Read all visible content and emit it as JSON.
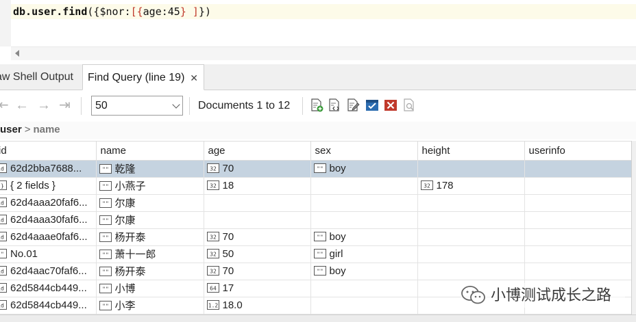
{
  "editor": {
    "code": {
      "t1": "db.user.find",
      "t2": "({",
      "t3": "$nor",
      "t4": ":",
      "t5": "[{",
      "t6": "age",
      "t7": ":",
      "t8": "45",
      "t9": "} ]",
      "t10": "})"
    }
  },
  "tabs": {
    "inactive_label": "aw Shell Output",
    "active_label": "Find Query (line 19)",
    "close_glyph": "✕"
  },
  "toolbar": {
    "nav": [
      "⇤",
      "←",
      "→",
      "⇥"
    ],
    "page_size": "50",
    "doc_count": "Documents 1 to 12",
    "icons": [
      "add-document-icon",
      "view-json-icon",
      "edit-document-icon",
      "save-icon",
      "delete-icon",
      "query-icon"
    ]
  },
  "breadcrumb": {
    "root": "user",
    "separator": ">",
    "current": "name"
  },
  "grid": {
    "columns": [
      "id",
      "name",
      "age",
      "sex",
      "height",
      "userinfo"
    ],
    "rows": [
      {
        "id": "62d2bba7688...",
        "id_type": "objectid",
        "name": "乾隆",
        "age": "70",
        "age_type": "int32",
        "sex": "boy",
        "height": "",
        "height_type": "",
        "selected": true
      },
      {
        "id": "{ 2 fields }",
        "id_type": "object",
        "name": "小燕子",
        "age": "18",
        "age_type": "int32",
        "sex": "",
        "height": "178",
        "height_type": "int32",
        "selected": false
      },
      {
        "id": "62d4aaa20faf6...",
        "id_type": "objectid",
        "name": "尔康",
        "age": "",
        "age_type": "",
        "sex": "",
        "height": "",
        "height_type": "",
        "selected": false
      },
      {
        "id": "62d4aaa30faf6...",
        "id_type": "objectid",
        "name": "尔康",
        "age": "",
        "age_type": "",
        "sex": "",
        "height": "",
        "height_type": "",
        "selected": false
      },
      {
        "id": "62d4aaae0faf6...",
        "id_type": "objectid",
        "name": "杨开泰",
        "age": "70",
        "age_type": "int32",
        "sex": "boy",
        "height": "",
        "height_type": "",
        "selected": false
      },
      {
        "id": "No.01",
        "id_type": "string",
        "name": "萧十一郎",
        "age": "50",
        "age_type": "int32",
        "sex": "girl",
        "height": "",
        "height_type": "",
        "selected": false
      },
      {
        "id": "62d4aac70faf6...",
        "id_type": "objectid",
        "name": "杨开泰",
        "age": "70",
        "age_type": "int32",
        "sex": "boy",
        "height": "",
        "height_type": "",
        "selected": false
      },
      {
        "id": "62d5844cb449...",
        "id_type": "objectid",
        "name": "小博",
        "age": "17",
        "age_type": "int64",
        "sex": "",
        "height": "",
        "height_type": "",
        "selected": false
      },
      {
        "id": "62d5844cb449...",
        "id_type": "objectid",
        "name": "小李",
        "age": "18.0",
        "age_type": "double",
        "sex": "",
        "height": "",
        "height_type": "",
        "selected": false
      }
    ]
  },
  "watermark": {
    "text": "小博测试成长之路"
  },
  "colors": {
    "selected_row": "#c5d3e0",
    "code_line_bg": "#fdfbe9",
    "save_icon_blue": "#2b6cb0",
    "delete_icon_red": "#c0392b"
  }
}
